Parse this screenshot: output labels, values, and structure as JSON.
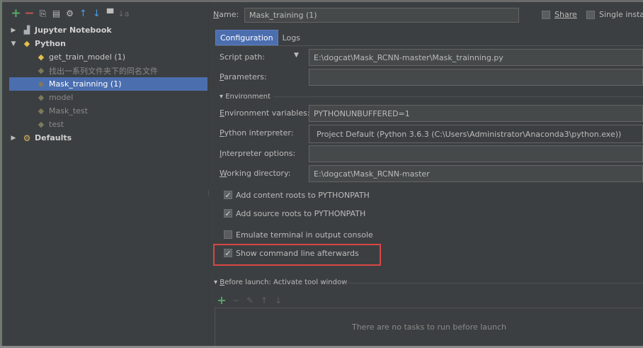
{
  "toolbar": {
    "add": "+",
    "remove": "−",
    "copy": "⎘",
    "save": "▤",
    "edit_defaults": "⚙",
    "move_up": "↑",
    "move_down": "↓",
    "folder": "▀",
    "sort": "↓a"
  },
  "tree": {
    "jupyter": "Jupyter Notebook",
    "python": "Python",
    "items": [
      "get_train_model (1)",
      "找出一系列文件夹下的同名文件",
      "Mask_trainning (1)",
      "model",
      "Mask_test",
      "test"
    ],
    "defaults": "Defaults"
  },
  "header": {
    "name_label": "Name:",
    "name_value": "Mask_training (1)",
    "share_label": "Share",
    "single_instance_label": "Single instan"
  },
  "tabs": {
    "configuration": "Configuration",
    "logs": "Logs"
  },
  "form": {
    "script_path_label": "Script path:",
    "script_path_value": "E:\\dogcat\\Mask_RCNN-master\\Mask_trainning.py",
    "parameters_label": "Parameters:",
    "environment_label": "Environment",
    "env_vars_label": "Environment variables:",
    "env_vars_value": "PYTHONUNBUFFERED=1",
    "interpreter_label": "Python interpreter:",
    "interpreter_value": "Project Default (Python 3.6.3 (C:\\Users\\Administrator\\Anaconda3\\python.exe))",
    "interpreter_options_label": "Interpreter options:",
    "working_dir_label": "Working directory:",
    "working_dir_value": "E:\\dogcat\\Mask_RCNN-master",
    "add_content_roots": "Add content roots to PYTHONPATH",
    "add_source_roots": "Add source roots to PYTHONPATH",
    "emulate_terminal": "Emulate terminal in output console",
    "show_command_line": "Show command line afterwards"
  },
  "before_launch": {
    "title": "Before launch: Activate tool window",
    "empty_text": "There are no tasks to run before launch"
  },
  "checkboxes": {
    "share": false,
    "single_instance": false,
    "add_content_roots": true,
    "add_source_roots": true,
    "emulate_terminal": false,
    "show_command_line": true
  },
  "colors": {
    "background": "#3c3f41",
    "selection": "#4b6eaf",
    "highlight_box": "#d94646",
    "add_green": "#59a869",
    "remove_red": "#c75450"
  }
}
